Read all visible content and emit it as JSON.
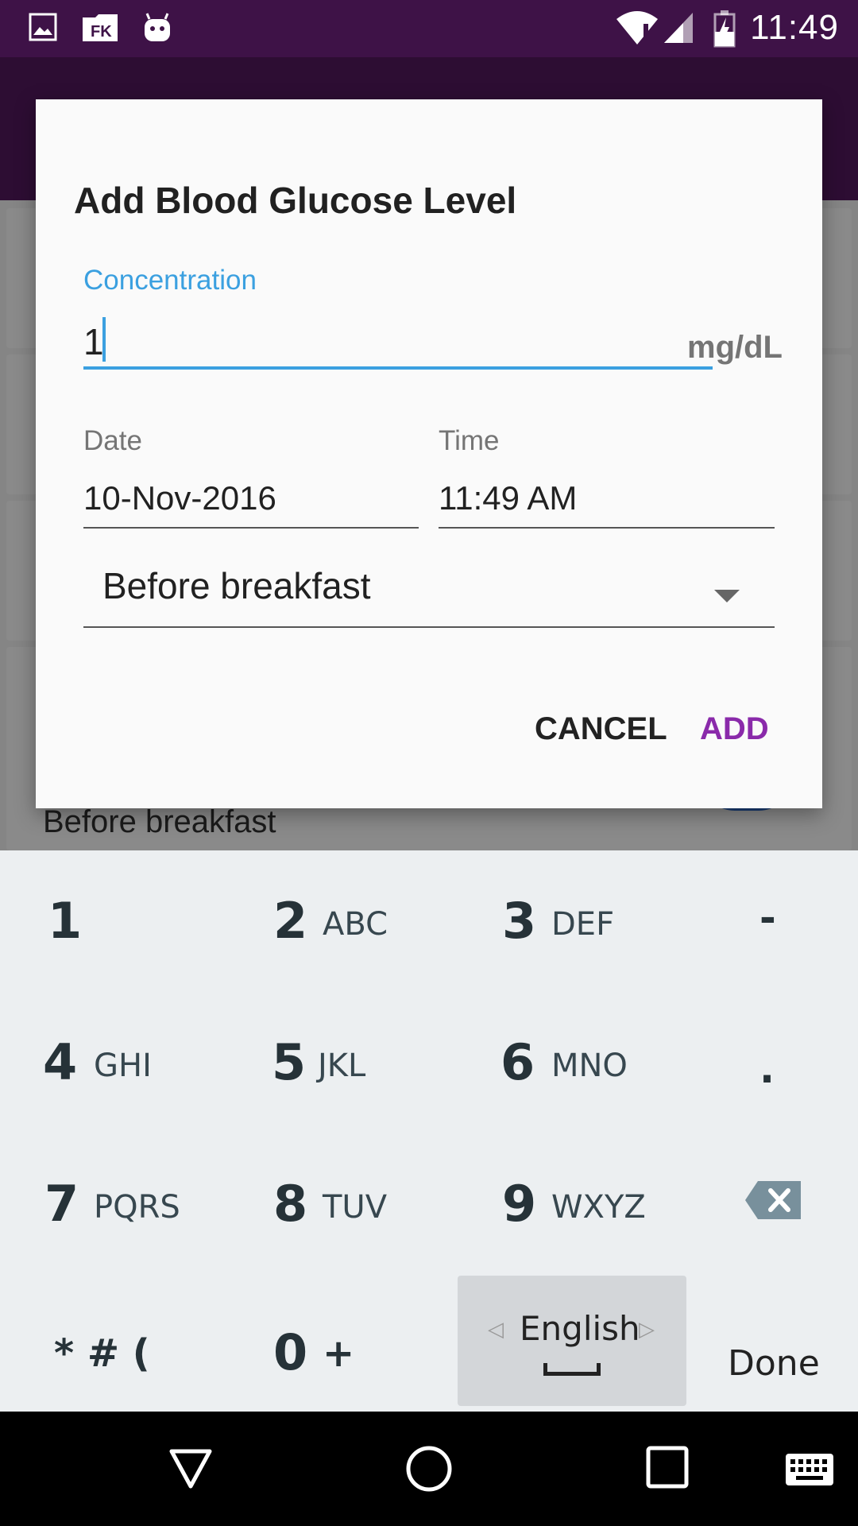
{
  "status_bar": {
    "time": "11:49",
    "icons": [
      "image-icon",
      "fk-app-icon",
      "android-icon",
      "wifi-icon",
      "signal-icon",
      "battery-charging-icon"
    ]
  },
  "background": {
    "meal_label": "Before breakfast"
  },
  "dialog": {
    "title": "Add Blood Glucose Level",
    "concentration": {
      "label": "Concentration",
      "value": "1",
      "unit": "mg/dL"
    },
    "date": {
      "label": "Date",
      "value": "10-Nov-2016"
    },
    "time": {
      "label": "Time",
      "value": "11:49 AM"
    },
    "meal": {
      "selected": "Before breakfast"
    },
    "buttons": {
      "cancel": "CANCEL",
      "add": "ADD"
    }
  },
  "keyboard": {
    "keys": [
      {
        "digit": "1",
        "letters": ""
      },
      {
        "digit": "2",
        "letters": "ABC"
      },
      {
        "digit": "3",
        "letters": "DEF"
      },
      {
        "digit": "4",
        "letters": "GHI"
      },
      {
        "digit": "5",
        "letters": "JKL"
      },
      {
        "digit": "6",
        "letters": "MNO"
      },
      {
        "digit": "7",
        "letters": "PQRS"
      },
      {
        "digit": "8",
        "letters": "TUV"
      },
      {
        "digit": "9",
        "letters": "WXYZ"
      },
      {
        "digit": "0",
        "letters": "+"
      }
    ],
    "minus": "-",
    "period": ".",
    "symbols": "* # (",
    "language": "English",
    "done": "Done"
  },
  "nav_bar": {
    "icons": [
      "back-icon",
      "home-icon",
      "recents-icon",
      "keyboard-icon"
    ]
  },
  "colors": {
    "status_bar": "#3e1247",
    "app_bar": "#54185f",
    "accent_blue": "#3ba0e0",
    "add_button": "#8a2aaa"
  }
}
